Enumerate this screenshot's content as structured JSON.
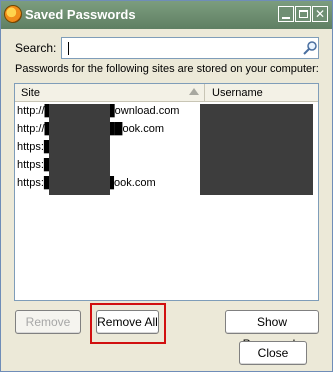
{
  "window": {
    "title": "Saved Passwords",
    "controls": {
      "minimize": "minimize-icon",
      "maximize": "maximize-icon",
      "close": "close-icon"
    }
  },
  "search": {
    "label": "Search:",
    "value": "",
    "icon": "magnifier-icon"
  },
  "description": "Passwords for the following sites are stored on your computer:",
  "table": {
    "columns": [
      "Site",
      "Username"
    ],
    "rows": [
      {
        "site": "http://█████████ownload.com"
      },
      {
        "site": "http://██████████ook.com"
      },
      {
        "site": "https:██████"
      },
      {
        "site": "https:██████"
      },
      {
        "site": "https:█████████ook.com"
      }
    ]
  },
  "buttons": {
    "remove": "Remove",
    "remove_all": "Remove All",
    "show_passwords": "Show Passwords",
    "close": "Close"
  },
  "colors": {
    "titlebar": "#6f8f73",
    "highlight": "#d11010",
    "redaction": "#3d3d3d"
  }
}
